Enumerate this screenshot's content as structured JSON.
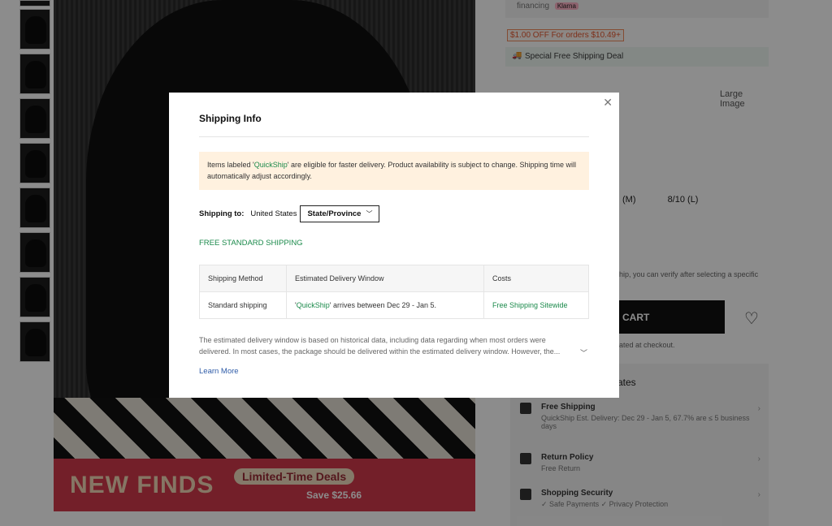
{
  "background": {
    "financing_text": "financing",
    "klarna_label": "Klarna",
    "coupon_text": "$1.00 OFF For orders $10.49+",
    "special_shipping": "Special Free Shipping Deal",
    "large_image_label": "Large Image",
    "sizes": [
      "(M)",
      "8/10 (L)"
    ],
    "verify_text": "hip, you can verify after selecting a specific",
    "cart_label": "CART",
    "checkout_note": "ated at checkout.",
    "updates_label": "ates",
    "promo": {
      "title": "NEW FINDS",
      "deals": "Limited-Time Deals",
      "save": "Save $25.66"
    },
    "shipping_rows": [
      {
        "title": "Free Shipping",
        "sub": "QuickShip  Est. Delivery: Dec 29 - Jan 5, 67.7% are ≤ 5 business days"
      },
      {
        "title": "Return Policy",
        "sub": "Free Return"
      },
      {
        "title": "Shopping Security",
        "sub": "✓ Safe Payments   ✓ Privacy Protection"
      }
    ]
  },
  "modal": {
    "title": "Shipping Info",
    "notice": {
      "before": "Items labeled '",
      "quickship": "QuickShip",
      "after": "' are eligible for faster delivery. Product availability is subject to change. Shipping time will automatically adjust accordingly."
    },
    "shipping_to_label": "Shipping to:",
    "country": "United States",
    "state_placeholder": "State/Province",
    "free_standard": "FREE STANDARD SHIPPING",
    "table": {
      "headers": [
        "Shipping Method",
        "Estimated Delivery Window",
        "Costs"
      ],
      "row": {
        "method": "Standard shipping",
        "quote_open": "'",
        "quickship": "QuickShip",
        "window_rest": "' arrives between Dec 29 - Jan 5.",
        "cost": "Free Shipping Sitewide"
      }
    },
    "description": "The estimated delivery window is based on historical data, including data regarding when most orders were delivered. In most cases, the package should be delivered within the estimated delivery window. However, the...",
    "learn_more": "Learn More",
    "close_glyph": "✕"
  },
  "colors": {
    "accent_green": "#1b8a4b",
    "notice_bg": "#fff1df",
    "link_blue": "#2f5ca8"
  },
  "icons": [
    "close-icon",
    "chevron-down-icon",
    "truck-icon",
    "heart-icon"
  ]
}
